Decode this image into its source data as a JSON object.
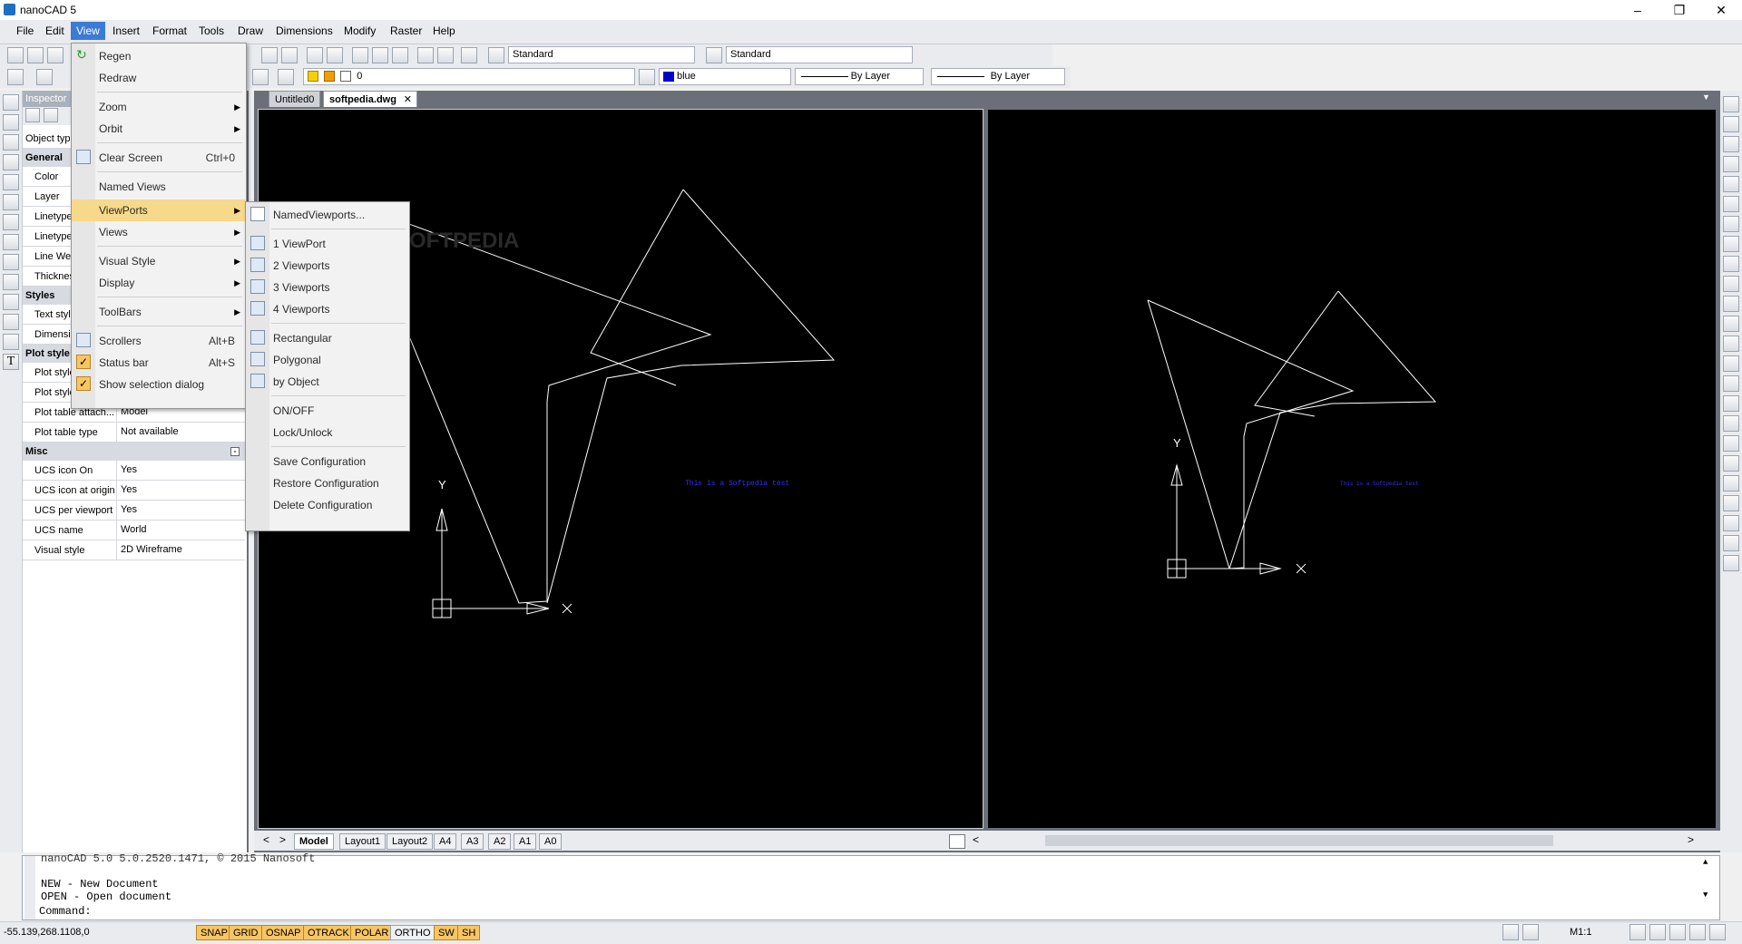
{
  "app": {
    "title": "nanoCAD 5"
  },
  "menubar": [
    "File",
    "Edit",
    "View",
    "Insert",
    "Format",
    "Tools",
    "Draw",
    "Dimensions",
    "Modify",
    "Raster",
    "Help"
  ],
  "toolbar": {
    "text_style": "Standard",
    "dim_style": "Standard",
    "layer": "0",
    "color": "blue",
    "linetype": "By Layer",
    "lineweight": "By Layer"
  },
  "inspector": {
    "title": "Inspector",
    "object_type_label": "Object typ",
    "sections": {
      "general": "General",
      "styles": "Styles",
      "plot": "Plot style",
      "misc": "Misc"
    },
    "general_rows": [
      "Color",
      "Layer",
      "Linetype",
      "Linetype",
      "Line We",
      "Thicknes"
    ],
    "style_rows": [
      "Text style",
      "Dimensi"
    ],
    "plot_rows": [
      "Plot style",
      "Plot style"
    ],
    "plot_table_rows": [
      {
        "key": "Plot table attach...",
        "value": "Model"
      },
      {
        "key": "Plot table type",
        "value": "Not available"
      }
    ],
    "misc_rows": [
      {
        "key": "UCS icon On",
        "value": "Yes"
      },
      {
        "key": "UCS icon at origin",
        "value": "Yes"
      },
      {
        "key": "UCS per viewport",
        "value": "Yes"
      },
      {
        "key": "UCS name",
        "value": "World"
      },
      {
        "key": "Visual style",
        "value": "2D Wireframe"
      }
    ]
  },
  "doc_tabs": [
    "Untitled0",
    "softpedia.dwg"
  ],
  "layout_tabs": [
    "Model",
    "Layout1",
    "Layout2",
    "A4",
    "A3",
    "A2",
    "A1",
    "A0"
  ],
  "drawing": {
    "left_text": "This is a Softpedia test",
    "right_text": "This is a Softpedia test",
    "watermark": "SOFTPEDIA",
    "axis_y": "Y",
    "axis_x": "X"
  },
  "view_menu": {
    "items": [
      {
        "label": "Regen",
        "shortcut": "",
        "submenu": false
      },
      {
        "label": "Redraw",
        "shortcut": "",
        "submenu": false
      },
      {
        "label": "Zoom",
        "shortcut": "",
        "submenu": true
      },
      {
        "label": "Orbit",
        "shortcut": "",
        "submenu": true
      },
      {
        "label": "Clear Screen",
        "shortcut": "Ctrl+0",
        "submenu": false
      },
      {
        "label": "Named Views",
        "shortcut": "",
        "submenu": false
      },
      {
        "label": "ViewPorts",
        "shortcut": "",
        "submenu": true
      },
      {
        "label": "Views",
        "shortcut": "",
        "submenu": true
      },
      {
        "label": "Visual Style",
        "shortcut": "",
        "submenu": true
      },
      {
        "label": "Display",
        "shortcut": "",
        "submenu": true
      },
      {
        "label": "ToolBars",
        "shortcut": "",
        "submenu": true
      },
      {
        "label": "Scrollers",
        "shortcut": "Alt+B",
        "submenu": false
      },
      {
        "label": "Status bar",
        "shortcut": "Alt+S",
        "submenu": false
      },
      {
        "label": "Show selection dialog",
        "shortcut": "",
        "submenu": false
      }
    ]
  },
  "viewports_menu": {
    "items": [
      "NamedViewports...",
      "1 ViewPort",
      "2 Viewports",
      "3 Viewports",
      "4 Viewports",
      "Rectangular",
      "Polygonal",
      "by Object",
      "ON/OFF",
      "Lock/Unlock",
      "Save Configuration",
      "Restore Configuration",
      "Delete Configuration"
    ]
  },
  "command": {
    "lines": [
      "nanoCAD 5.0 5.0.2520.1471, © 2015 Nanosoft",
      "",
      "NEW - New Document",
      "OPEN - Open document",
      "Command:"
    ]
  },
  "status": {
    "coords": "-55.139,268.1108,0",
    "buttons": [
      "SNAP",
      "GRID",
      "OSNAP",
      "OTRACK",
      "POLAR",
      "ORTHO",
      "SW",
      "SH"
    ],
    "scale": "M1:1"
  },
  "colors": {
    "active_toggle": "#f8c563",
    "highlight": "#f7d98b",
    "menu_active": "#3b7bd4"
  }
}
